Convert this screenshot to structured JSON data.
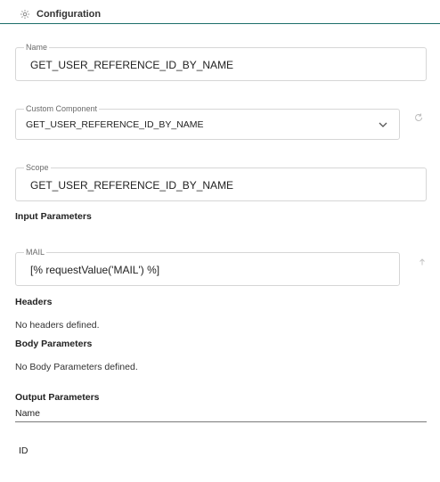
{
  "header": {
    "title": "Configuration",
    "icon": "gear-icon"
  },
  "name_field": {
    "label": "Name",
    "value": "GET_USER_REFERENCE_ID_BY_NAME"
  },
  "component_field": {
    "label": "Custom Component",
    "value": "GET_USER_REFERENCE_ID_BY_NAME"
  },
  "scope_field": {
    "label": "Scope",
    "value": "GET_USER_REFERENCE_ID_BY_NAME"
  },
  "input_params": {
    "heading": "Input Parameters",
    "mail": {
      "label": "MAIL",
      "value": "[% requestValue('MAIL') %]"
    }
  },
  "headers": {
    "heading": "Headers",
    "empty_text": "No headers defined."
  },
  "body_params": {
    "heading": "Body Parameters",
    "empty_text": "No Body Parameters defined."
  },
  "output_params": {
    "heading": "Output Parameters",
    "column": "Name",
    "rows": [
      "ID"
    ]
  },
  "colors": {
    "accent_line": "#1d6f6a",
    "border": "#d6d6d6",
    "icon_gray": "#9e9e9e"
  }
}
